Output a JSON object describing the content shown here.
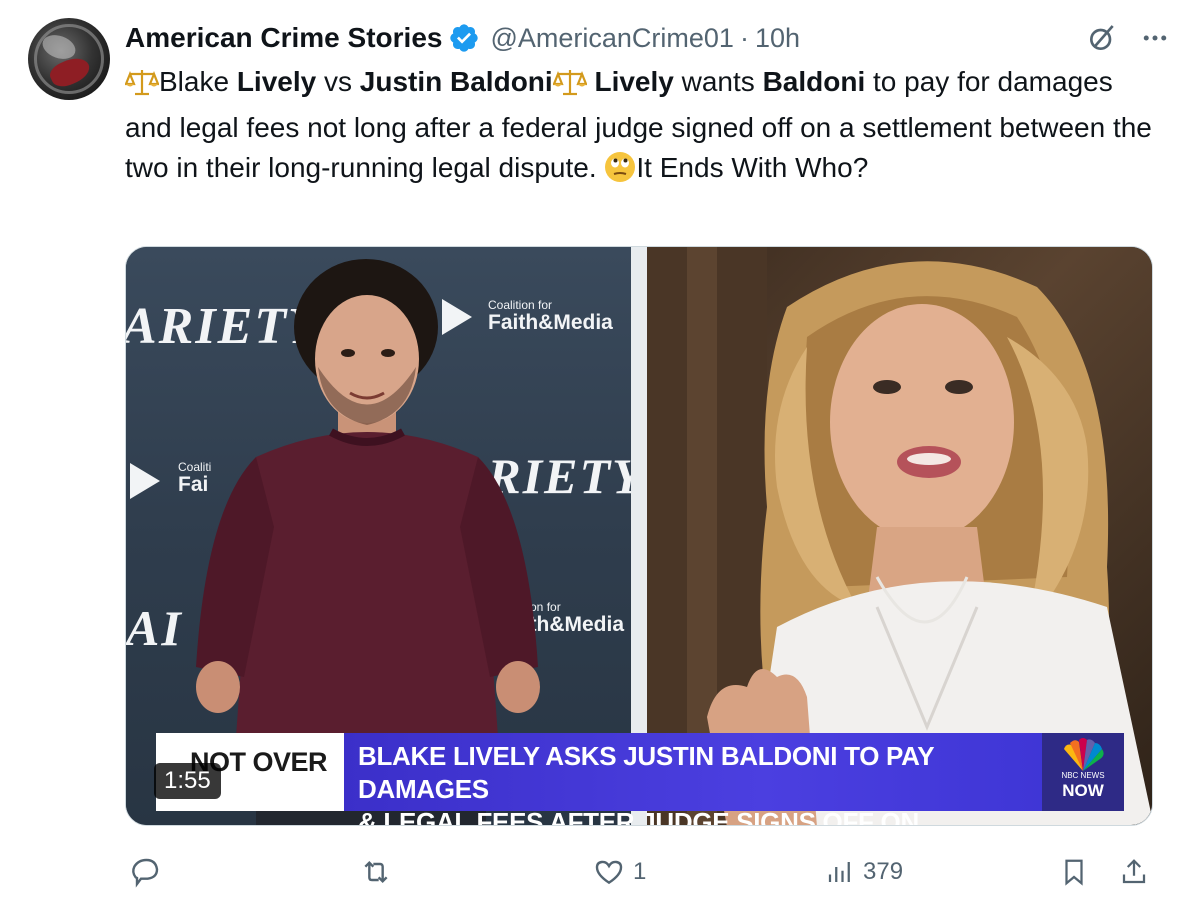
{
  "tweet": {
    "author": {
      "name": "American Crime Stories",
      "handle": "@AmericanCrime01",
      "separator": "·",
      "time": "10h"
    },
    "text": {
      "p1": "Blake ",
      "b1": "Lively",
      "p2": " vs ",
      "b2": "Justin Baldoni",
      "b3": "Lively",
      "p3": " wants ",
      "b4": "Baldoni",
      "p4": " to pay for damages and legal fees not long after a federal judge signed off on a settlement between the two in their long-running legal dispute. ",
      "p5": "It Ends With Who?"
    },
    "media": {
      "backdrop_logos": {
        "variety": "ARIETY",
        "coalition_small": "Coalition for",
        "coalition_big": "Faith&Media",
        "coalition_small_cut": "Coaliti",
        "coalition_big_cut": "Fai",
        "coalition_small_cut2": "alition for",
        "coalition_big_cut2": "aith&Media",
        "variety_cut": "AI"
      },
      "lower_third": {
        "tag": "NOT OVER",
        "headline_line1": "BLAKE LIVELY ASKS JUSTIN BALDONI TO PAY DAMAGES",
        "headline_line2": "& LEGAL FEES AFTER JUDGE SIGNS OFF ON SETTLEMENT",
        "network_small": "NBC NEWS",
        "network": "NOW"
      },
      "duration": "1:55"
    },
    "actions": {
      "reply_count": "",
      "repost_count": "",
      "like_count": "1",
      "views_count": "379"
    },
    "colors": {
      "verified": "#1d9bf0",
      "secondary_text": "#536471",
      "lower_third_purple": "#3b2fc9"
    }
  }
}
